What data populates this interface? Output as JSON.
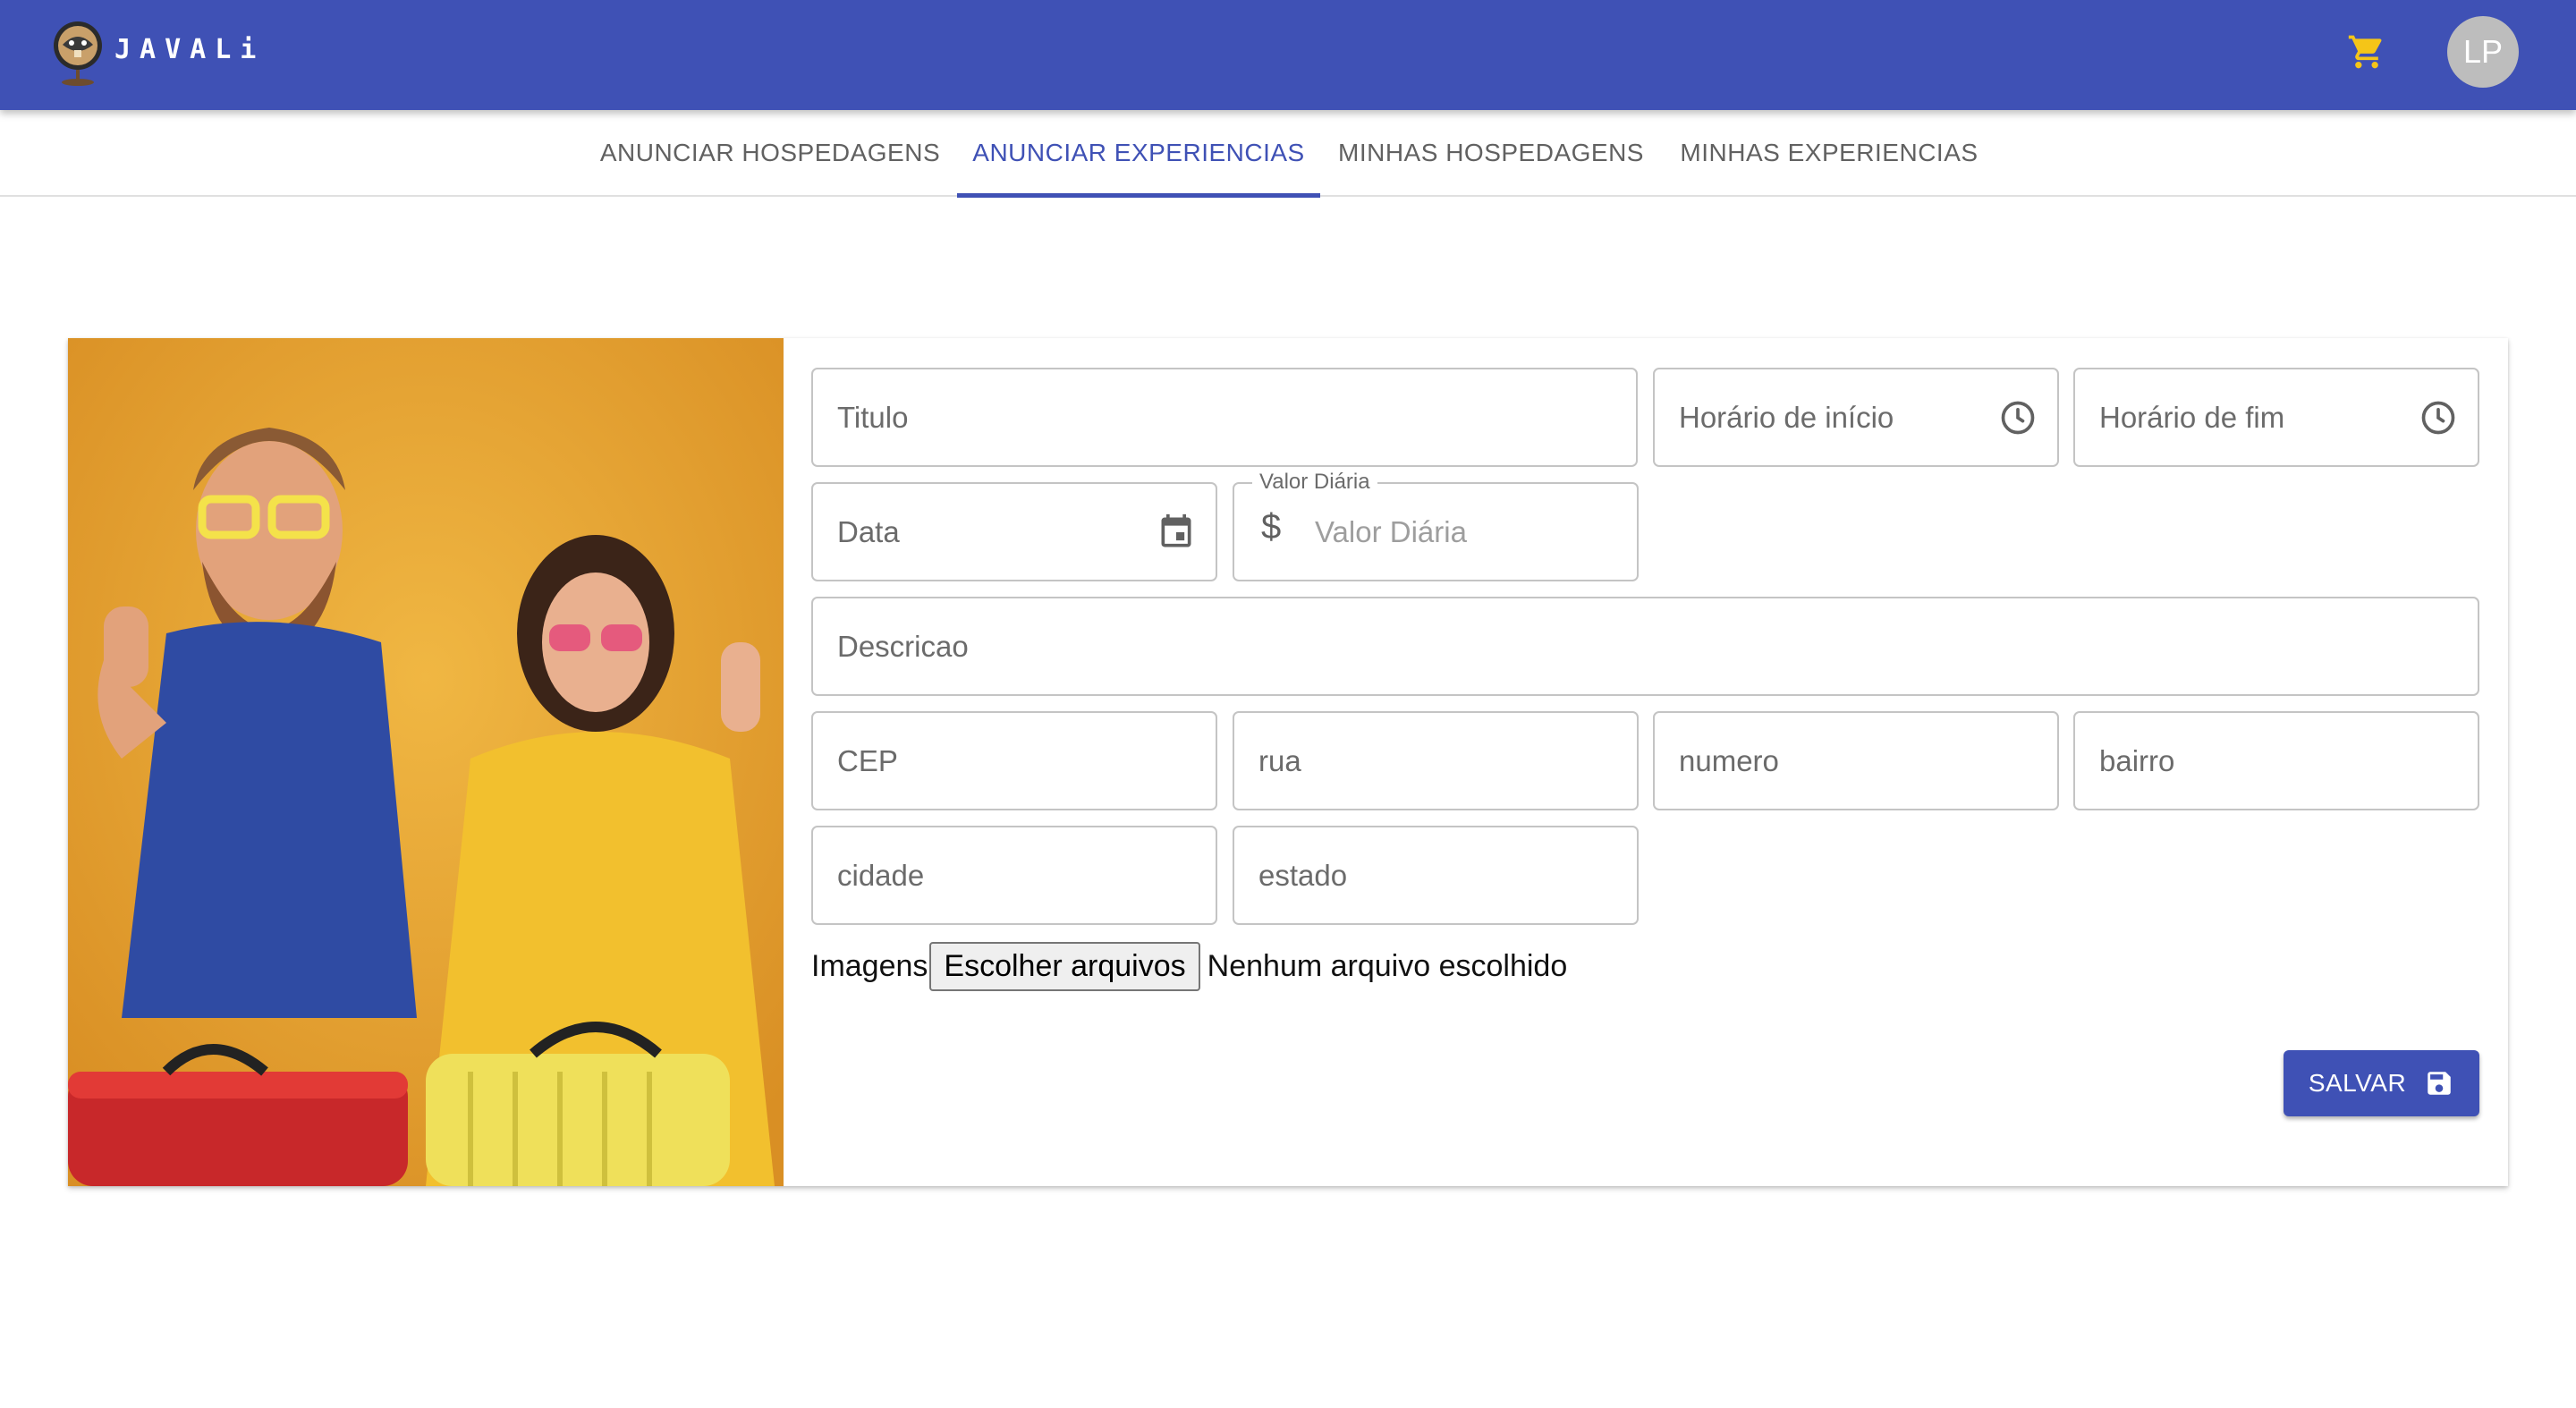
{
  "app": {
    "brand": "JAVALi"
  },
  "header": {
    "avatar_initials": "LP"
  },
  "tabs": [
    {
      "label": "ANUNCIAR HOSPEDAGENS",
      "active": false
    },
    {
      "label": "ANUNCIAR EXPERIENCIAS",
      "active": true
    },
    {
      "label": "MINHAS HOSPEDAGENS",
      "active": false
    },
    {
      "label": "MINHAS EXPERIENCIAS",
      "active": false
    }
  ],
  "form": {
    "titulo": "Titulo",
    "horario_inicio": "Horário de início",
    "horario_fim": "Horário de fim",
    "data": "Data",
    "valor_diaria_label": "Valor Diária",
    "valor_diaria_placeholder": "Valor Diária",
    "currency_symbol": "$",
    "descricao": "Descricao",
    "cep": "CEP",
    "rua": "rua",
    "numero": "numero",
    "bairro": "bairro",
    "cidade": "cidade",
    "estado": "estado",
    "imagens_label": "Imagens",
    "file_button": "Escolher arquivos",
    "file_status": "Nenhum arquivo escolhido",
    "save_label": "SALVAR"
  },
  "colors": {
    "primary": "#3f51b5",
    "cart": "#f5c518",
    "photo_bg": "#e7a434"
  },
  "icons": {
    "cart": "shopping-cart-icon",
    "clock": "clock-icon",
    "calendar": "calendar-icon",
    "save": "floppy-disk-icon"
  }
}
